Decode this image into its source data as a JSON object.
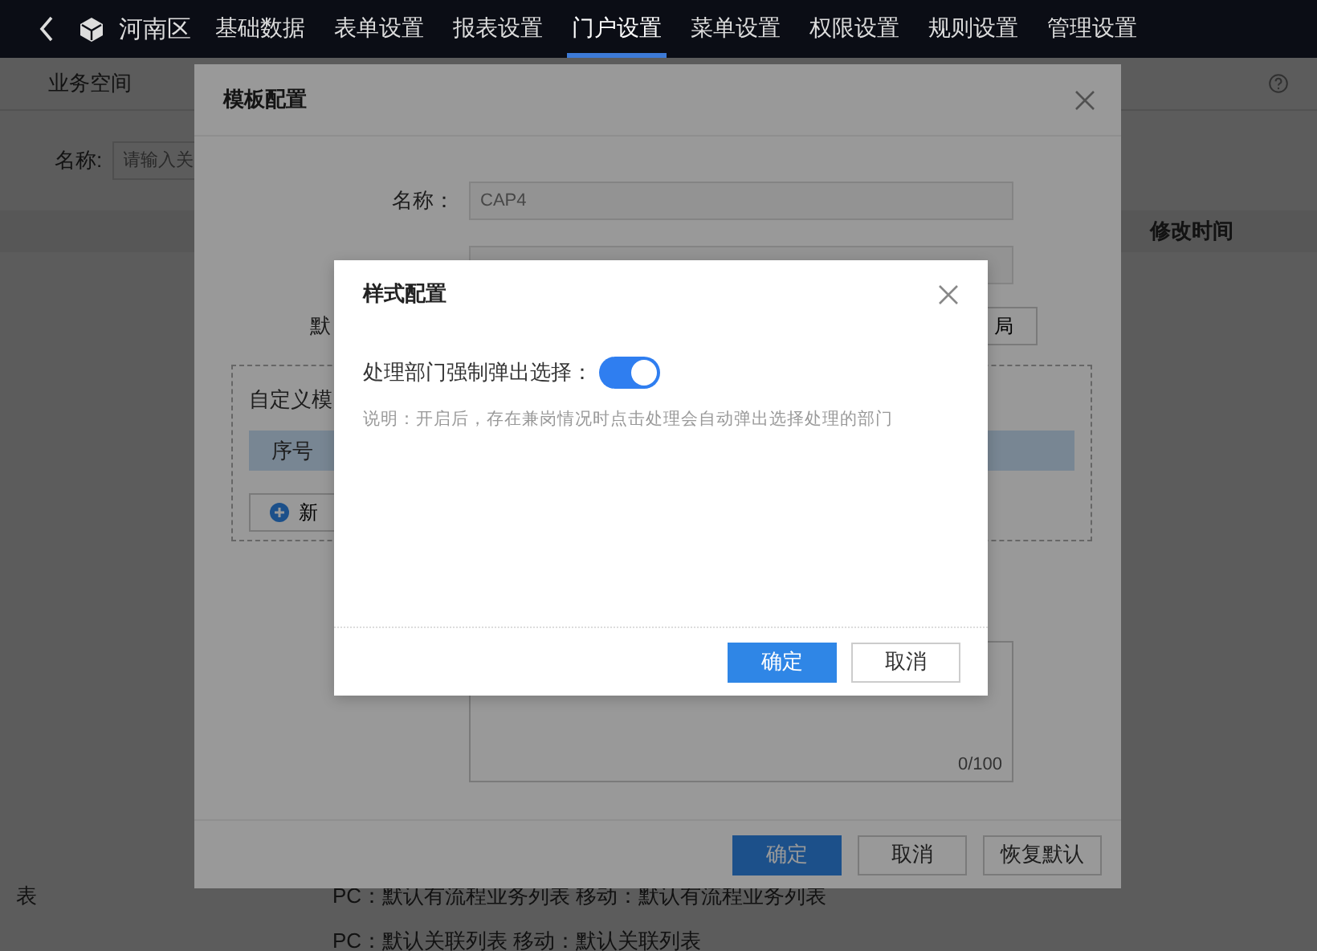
{
  "nav": {
    "region": "河南区",
    "tabs": [
      {
        "label": "基础数据",
        "selected": false
      },
      {
        "label": "表单设置",
        "selected": false
      },
      {
        "label": "报表设置",
        "selected": false
      },
      {
        "label": "门户设置",
        "selected": true
      },
      {
        "label": "菜单设置",
        "selected": false
      },
      {
        "label": "权限设置",
        "selected": false
      },
      {
        "label": "规则设置",
        "selected": false
      },
      {
        "label": "管理设置",
        "selected": false
      }
    ]
  },
  "page": {
    "title": "业务空间",
    "search_label": "名称:",
    "search_placeholder": "请输入关",
    "column_header": "修改时间",
    "row_label": "表",
    "rows": [
      "PC：默认有流程业务列表   移动：默认有流程业务列表",
      "PC：默认关联列表   移动：默认关联列表"
    ]
  },
  "template_dialog": {
    "title": "模板配置",
    "fields": [
      {
        "label": "名称：",
        "value": "CAP4"
      }
    ],
    "default_label": "默",
    "layout_button": "局",
    "custom_section": {
      "title": "自定义模",
      "column": "序号",
      "add_button": "新"
    },
    "counter": "0/100",
    "buttons": [
      {
        "label": "确定",
        "kind": "primary"
      },
      {
        "label": "取消",
        "kind": "default"
      },
      {
        "label": "恢复默认",
        "kind": "default"
      }
    ]
  },
  "style_dialog": {
    "title": "样式配置",
    "option": {
      "label": "处理部门强制弹出选择：",
      "on": true
    },
    "description": "说明：开启后，存在兼岗情况时点击处理会自动弹出选择处理的部门",
    "buttons": [
      {
        "label": "确定",
        "kind": "primary"
      },
      {
        "label": "取消",
        "kind": "default"
      }
    ]
  }
}
